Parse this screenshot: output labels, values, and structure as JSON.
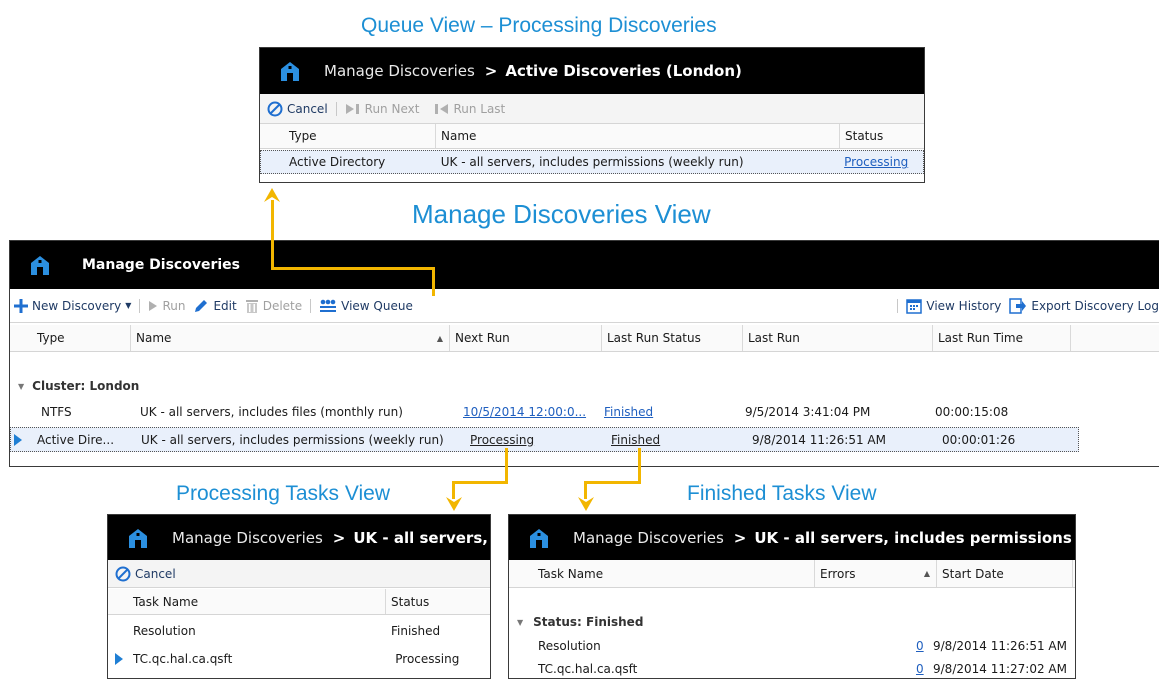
{
  "captions": {
    "queue": "Queue View – Processing Discoveries",
    "manage": "Manage Discoveries View",
    "processing": "Processing Tasks View",
    "finished": "Finished Tasks View"
  },
  "queue_window": {
    "title_main": "Manage Discoveries",
    "separator": ">",
    "title_sub": "Active Discoveries (London)",
    "toolbar": {
      "cancel": "Cancel",
      "run_next": "Run Next",
      "run_last": "Run Last"
    },
    "columns": [
      "Type",
      "Name",
      "Status"
    ],
    "rows": [
      {
        "type": "Active Directory",
        "name": "UK - all servers, includes permissions (weekly run)",
        "status": "Processing"
      }
    ]
  },
  "manage_window": {
    "title": "Manage Discoveries",
    "toolbar": {
      "new_discovery": "New Discovery",
      "run": "Run",
      "edit": "Edit",
      "delete": "Delete",
      "view_queue": "View Queue",
      "view_history": "View History",
      "export_log": "Export Discovery Log"
    },
    "columns": [
      "Type",
      "Name",
      "Next Run",
      "Last Run Status",
      "Last Run",
      "Last Run Time"
    ],
    "group_label": "Cluster: London",
    "rows": [
      {
        "type": "NTFS",
        "name": "UK - all servers, includes files (monthly run)",
        "next_run": "10/5/2014 12:00:0...",
        "last_status": "Finished",
        "last_run": "9/5/2014 3:41:04 PM",
        "last_time": "00:00:15:08"
      },
      {
        "type": "Active Dire...",
        "name": "UK - all servers, includes permissions (weekly run)",
        "next_run": "Processing",
        "last_status": "Finished",
        "last_run": "9/8/2014 11:26:51 AM",
        "last_time": "00:00:01:26"
      }
    ]
  },
  "processing_window": {
    "title_main": "Manage Discoveries",
    "separator": ">",
    "title_sub": "UK - all servers, includes permissions (weekly run)",
    "toolbar": {
      "cancel": "Cancel"
    },
    "columns": [
      "Task Name",
      "Status"
    ],
    "rows": [
      {
        "task": "Resolution",
        "status": "Finished"
      },
      {
        "task": "TC.qc.hal.ca.qsft",
        "status": "Processing"
      }
    ]
  },
  "finished_window": {
    "title_main": "Manage Discoveries",
    "separator": ">",
    "title_sub": "UK - all servers, includes permissions (weekly run)",
    "columns": [
      "Task Name",
      "Errors",
      "Start Date"
    ],
    "group_label": "Status: Finished",
    "rows": [
      {
        "task": "Resolution",
        "errors": "0",
        "start": "9/8/2014 11:26:51 AM"
      },
      {
        "task": "TC.qc.hal.ca.qsft",
        "errors": "0",
        "start": "9/8/2014 11:27:02 AM"
      }
    ]
  },
  "colors": {
    "caption": "#1d8fd4",
    "arrow": "#f2b600",
    "titlebar": "#000000",
    "accent": "#1f6fd0"
  }
}
